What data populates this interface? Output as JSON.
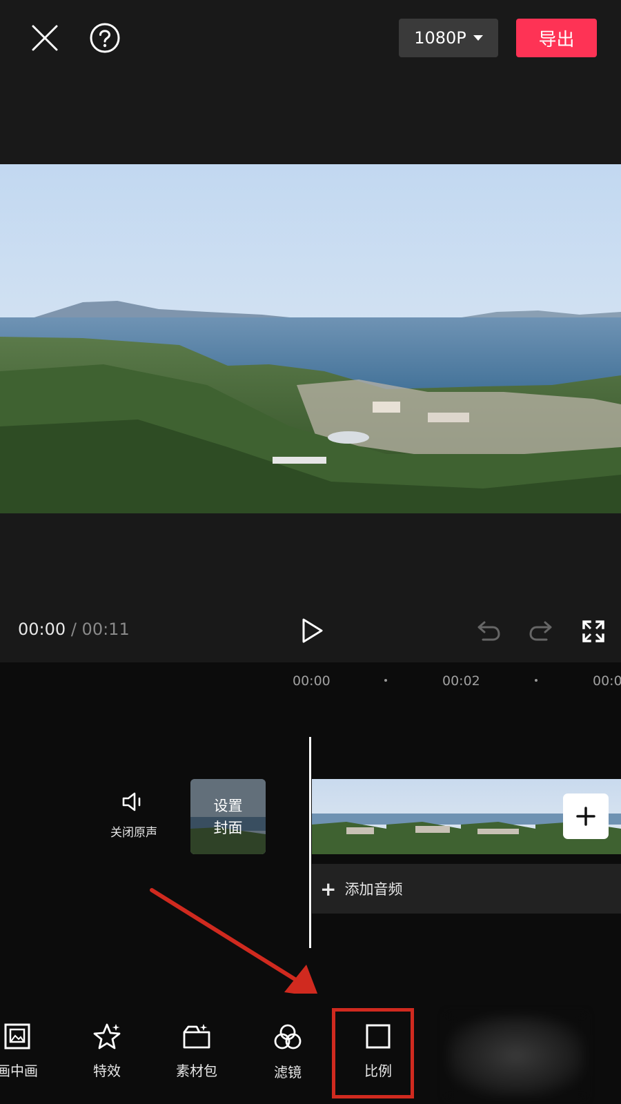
{
  "header": {
    "resolution_label": "1080P",
    "export_label": "导出"
  },
  "player": {
    "current_time": "00:00",
    "separator": "/",
    "total_time": "00:11"
  },
  "timeline": {
    "ticks": [
      "00:00",
      "00:02",
      "00:0"
    ],
    "mute_label": "关闭原声",
    "cover_line1": "设置",
    "cover_line2": "封面",
    "add_audio_label": "添加音频"
  },
  "toolbar": {
    "items": [
      {
        "label": "画中画",
        "icon": "pip-icon"
      },
      {
        "label": "特效",
        "icon": "effects-star-icon"
      },
      {
        "label": "素材包",
        "icon": "sticker-pack-icon"
      },
      {
        "label": "滤镜",
        "icon": "filter-icon"
      },
      {
        "label": "比例",
        "icon": "ratio-icon"
      }
    ]
  },
  "colors": {
    "accent": "#fe3355",
    "annotation": "#d02a1f"
  }
}
